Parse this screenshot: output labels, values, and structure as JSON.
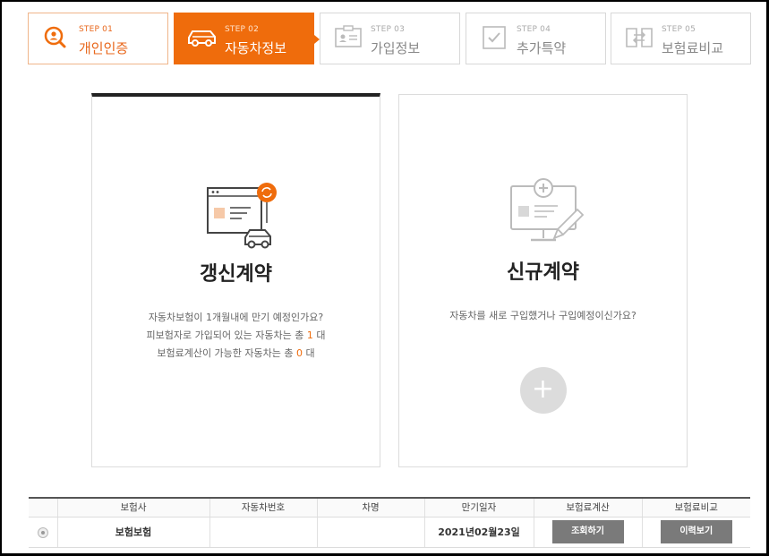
{
  "accent_color": "#ef6c0c",
  "steps": [
    {
      "num": "STEP 01",
      "label": "개인인증",
      "state": "done",
      "icon": "user-search-icon"
    },
    {
      "num": "STEP 02",
      "label": "자동차정보",
      "state": "active",
      "icon": "car-icon"
    },
    {
      "num": "STEP 03",
      "label": "가입정보",
      "state": "pending",
      "icon": "id-card-icon"
    },
    {
      "num": "STEP 04",
      "label": "추가특약",
      "state": "pending",
      "icon": "checkbox-icon"
    },
    {
      "num": "STEP 05",
      "label": "보험료비교",
      "state": "pending",
      "icon": "compare-icon"
    }
  ],
  "renewal": {
    "title": "갱신계약",
    "line1": "자동차보험이 1개월내에 만기 예정인가요?",
    "line2_pre": "피보험자로 가입되어 있는 자동차는 총",
    "line2_count": "1",
    "line2_post": "대",
    "line3_pre": "보험료계산이 가능한 자동차는 총",
    "line3_count": "0",
    "line3_post": "대"
  },
  "new_contract": {
    "title": "신규계약",
    "desc": "자동차를 새로 구입했거나 구입예정이신가요?",
    "add_symbol": "+"
  },
  "table": {
    "headers": [
      "",
      "보험사",
      "자동차번호",
      "차명",
      "만기일자",
      "보험료계산",
      "보험료비교"
    ],
    "rows": [
      {
        "insurer": "보험보험",
        "car_number": "",
        "car_name": "",
        "expiry": "2021년02월23일",
        "calc_button": "조회하기",
        "compare_button": "이력보기"
      }
    ]
  }
}
